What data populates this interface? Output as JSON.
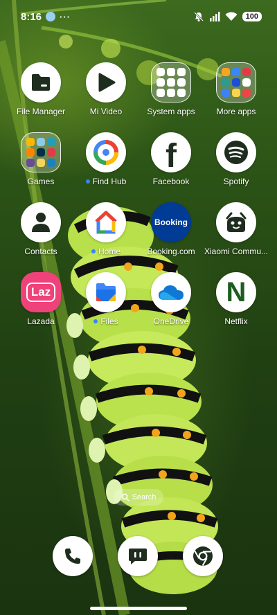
{
  "status_bar": {
    "time": "8:16",
    "dots": "···",
    "battery": "100",
    "icons": [
      "notification-app-icon",
      "mute-bell-icon",
      "signal-icon",
      "wifi-icon",
      "battery-icon"
    ]
  },
  "apps": [
    {
      "label": "File Manager",
      "icon": "folder-icon",
      "new": false
    },
    {
      "label": "Mi Video",
      "icon": "play-icon",
      "new": false
    },
    {
      "label": "System apps",
      "icon": "folder-grid",
      "new": false
    },
    {
      "label": "More apps",
      "icon": "folder-grid",
      "new": false
    },
    {
      "label": "Games",
      "icon": "folder-grid",
      "new": false
    },
    {
      "label": "Find Hub",
      "icon": "find-hub-icon",
      "new": true
    },
    {
      "label": "Facebook",
      "icon": "facebook-icon",
      "new": false
    },
    {
      "label": "Spotify",
      "icon": "spotify-icon",
      "new": false
    },
    {
      "label": "Contacts",
      "icon": "person-icon",
      "new": false
    },
    {
      "label": "Home",
      "icon": "google-home-icon",
      "new": true
    },
    {
      "label": "Booking.com",
      "icon": "booking-icon",
      "new": false
    },
    {
      "label": "Xiaomi Commu...",
      "icon": "xiaomi-community-icon",
      "new": false
    },
    {
      "label": "Lazada",
      "icon": "lazada-icon",
      "new": false
    },
    {
      "label": "Files",
      "icon": "files-icon",
      "new": true
    },
    {
      "label": "OneDrive",
      "icon": "onedrive-icon",
      "new": false
    },
    {
      "label": "Netflix",
      "icon": "netflix-icon",
      "new": false
    }
  ],
  "icon_text": {
    "booking": "Booking",
    "lazada": "Laz",
    "facebook": "f",
    "netflix": "N"
  },
  "search": {
    "label": "Search"
  },
  "dock": [
    {
      "icon": "phone-icon"
    },
    {
      "icon": "messages-icon"
    },
    {
      "icon": "chrome-icon"
    }
  ],
  "colors": {
    "new_dot": "#3b82f6",
    "booking_bg": "#003b95",
    "lazada_pink": "#f0427a",
    "netflix_green": "#1b5e20"
  }
}
